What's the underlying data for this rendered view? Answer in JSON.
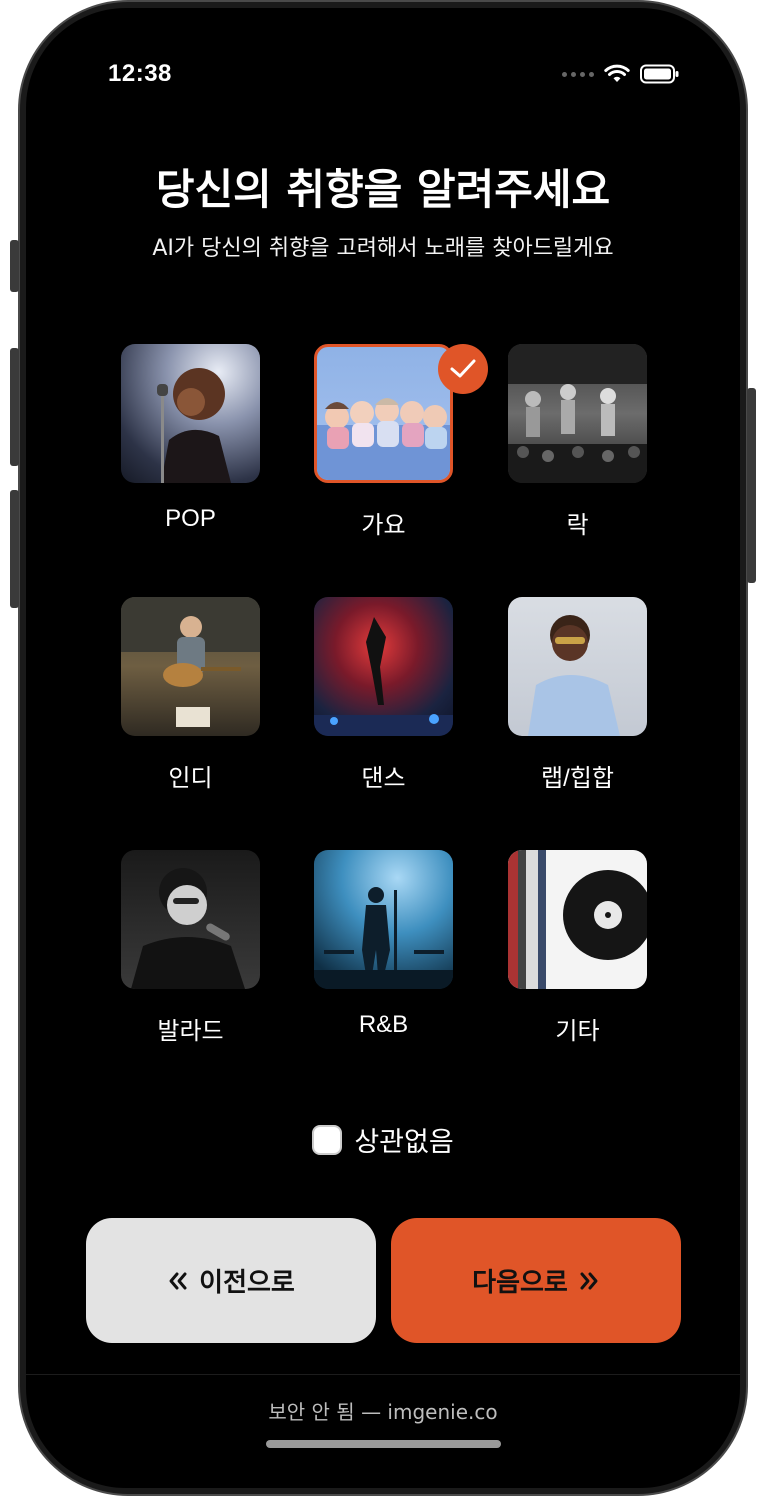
{
  "status_bar": {
    "time": "12:38"
  },
  "header": {
    "title": "당신의 취향을 알려주세요",
    "subtitle": "AI가 당신의 취향을 고려해서 노래를 찾아드릴게요"
  },
  "genres": [
    {
      "label": "POP",
      "selected": false,
      "image": "singer with microphone"
    },
    {
      "label": "가요",
      "selected": true,
      "image": "kpop girl group"
    },
    {
      "label": "락",
      "selected": false,
      "image": "rock concert stage"
    },
    {
      "label": "인디",
      "selected": false,
      "image": "acoustic guitarist"
    },
    {
      "label": "댄스",
      "selected": false,
      "image": "breakdancer on stage"
    },
    {
      "label": "랩/힙합",
      "selected": false,
      "image": "rapper portrait"
    },
    {
      "label": "발라드",
      "selected": false,
      "image": "ballad singer"
    },
    {
      "label": "R&B",
      "selected": false,
      "image": "silhouette performer"
    },
    {
      "label": "기타",
      "selected": false,
      "image": "vinyl record"
    }
  ],
  "no_preference": {
    "label": "상관없음",
    "checked": false
  },
  "buttons": {
    "prev_label": "이전으로",
    "next_label": "다음으로"
  },
  "footer": {
    "url_text": "보안 안 됨 — imgenie.co"
  },
  "colors": {
    "accent": "#e05528",
    "background": "#000000",
    "secondary_button": "#e3e3e3"
  },
  "icons": {
    "check": "check-icon",
    "prev": "double-chevron-left-icon",
    "next": "double-chevron-right-icon"
  }
}
